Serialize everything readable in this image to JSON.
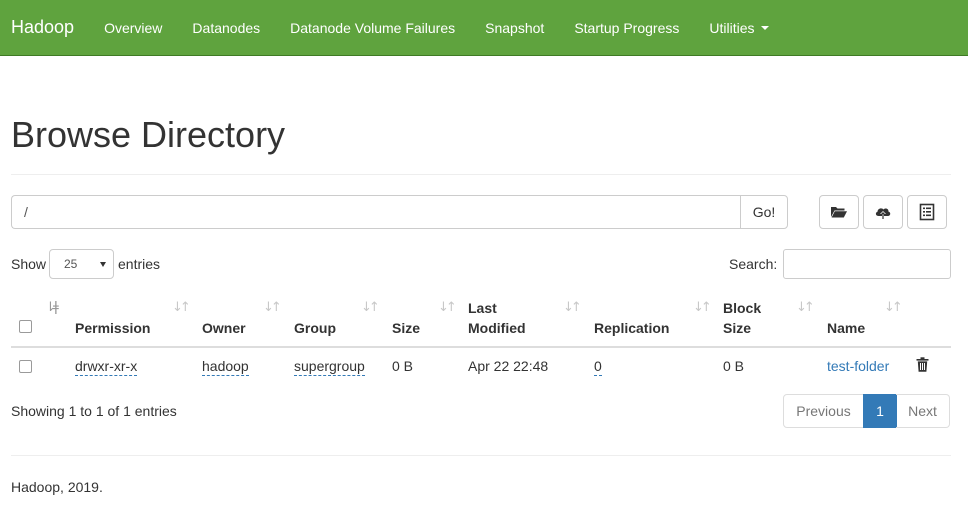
{
  "navbar": {
    "brand": "Hadoop",
    "items": [
      "Overview",
      "Datanodes",
      "Datanode Volume Failures",
      "Snapshot",
      "Startup Progress",
      "Utilities"
    ]
  },
  "page_title": "Browse Directory",
  "path_bar": {
    "value": "/",
    "go_label": "Go!"
  },
  "toolbar_icons": [
    "folder-open-icon",
    "cloud-upload-icon",
    "list-alt-icon"
  ],
  "controls": {
    "show_label": "Show",
    "page_length": "25",
    "entries_label": "entries",
    "search_label": "Search:"
  },
  "table": {
    "headers": {
      "permission": "Permission",
      "owner": "Owner",
      "group": "Group",
      "size": "Size",
      "last_modified_1": "Last",
      "last_modified_2": "Modified",
      "replication": "Replication",
      "block_size_1": "Block",
      "block_size_2": "Size",
      "name": "Name"
    },
    "rows": [
      {
        "permission": "drwxr-xr-x",
        "owner": "hadoop",
        "group": "supergroup",
        "size": "0 B",
        "last_modified": "Apr 22 22:48",
        "replication": "0",
        "block_size": "0 B",
        "name": "test-folder"
      }
    ]
  },
  "info": "Showing 1 to 1 of 1 entries",
  "pagination": {
    "previous": "Previous",
    "current": "1",
    "next": "Next"
  },
  "footer": "Hadoop, 2019.",
  "colors": {
    "navbar": "#5fa33e",
    "link": "#337ab7",
    "active_page": "#337ab7"
  }
}
